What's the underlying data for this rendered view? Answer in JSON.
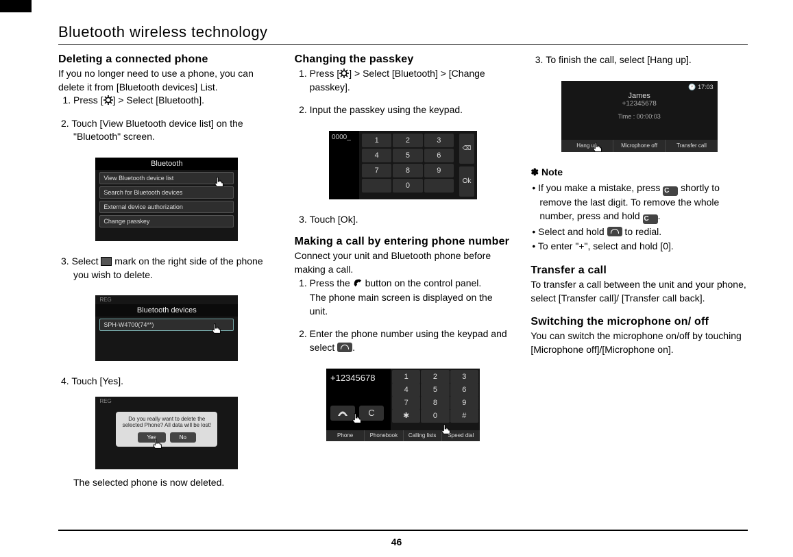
{
  "page_title": "Bluetooth wireless technology",
  "page_number": "46",
  "col1": {
    "h_delete": "Deleting a connected phone",
    "delete_intro": "If you no longer need to use a phone, you can delete it from [Bluetooth devices] List.",
    "delete_step1_a": "Press [",
    "delete_step1_b": "] > Select [Bluetooth].",
    "delete_step2": "2. Touch [View Bluetooth device list] on the \"Bluetooth\" screen.",
    "delete_step3_a": "3. Select ",
    "delete_step3_b": " mark on the right side of the phone you wish to delete.",
    "delete_step4": "4. Touch [Yes].",
    "delete_result": "The selected phone is now deleted.",
    "ss1_header": "Bluetooth",
    "ss1_rows": [
      "View Bluetooth device list",
      "Search for Bluetooth devices",
      "External device authorization",
      "Change passkey"
    ],
    "ss2_header": "Bluetooth devices",
    "ss2_device": "SPH-W4700(74**)",
    "ss3_msg": "Do you really want to delete the selected Phone? All data will be lost!",
    "ss3_yes": "Yes",
    "ss3_no": "No"
  },
  "col2": {
    "h_passkey": "Changing the passkey",
    "passkey_step1_a": "Press [",
    "passkey_step1_b": "] > Select [Bluetooth] > [Change passkey].",
    "passkey_step2": "Input the passkey using the keypad.",
    "passkey_step3": "Touch [Ok].",
    "ss_keypad_header": "0000_",
    "ss_keypad_ok": "Ok",
    "h_makecall": "Making a call by entering phone number",
    "makecall_intro": "Connect your unit and Bluetooth phone before making a call.",
    "makecall_step1_a": "Press the ",
    "makecall_step1_b": " button on the control panel.",
    "makecall_step1_c": "The phone main screen is displayed on the unit.",
    "makecall_step2_a": "Enter the phone number using the keypad and select ",
    "makecall_step2_b": ".",
    "ss_dial_number": "+12345678",
    "ss_dial_tabs": [
      "Phone",
      "Phonebook",
      "Calling lists",
      "Speed dial"
    ]
  },
  "col3": {
    "finish_step3": "To finish the call, select [Hang up].",
    "ss_call_name": "James",
    "ss_call_num": "+12345678",
    "ss_call_time_label": "Time : 00:00:03",
    "ss_call_clock": "17:03",
    "ss_call_btns": [
      "Hang up",
      "Microphone off",
      "Transfer call"
    ],
    "note_label": "✽ Note",
    "note1_a": "• If you make a mistake, press ",
    "note1_b": " shortly to remove the last digit. To remove the whole number, press and hold ",
    "note1_c": ".",
    "note2_a": "• Select and hold ",
    "note2_b": " to redial.",
    "note3": "• To enter \"+\", select and hold [0].",
    "h_transfer": "Transfer a call",
    "transfer_body": "To transfer a call between the unit and your phone, select [Transfer call]/ [Transfer call back].",
    "h_mic": "Switching the microphone on/ off",
    "mic_body": "You can switch the microphone on/off by touching [Microphone off]/[Microphone on]."
  }
}
